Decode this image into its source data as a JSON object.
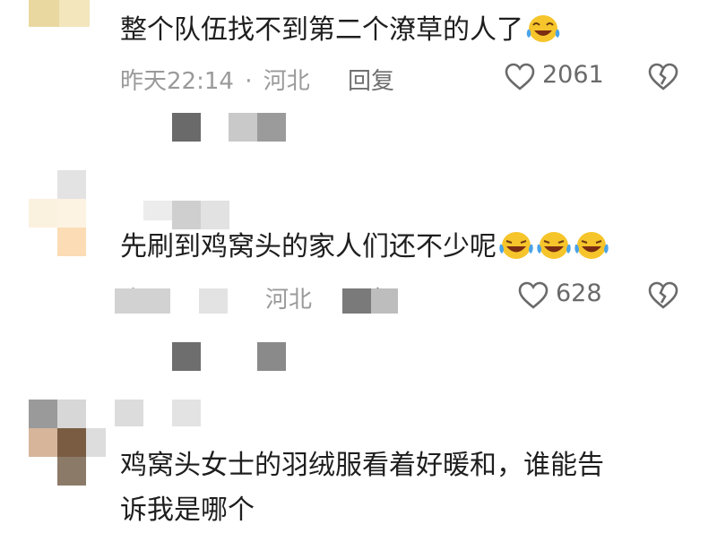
{
  "comments": [
    {
      "text": "整个队伍找不到第二个潦草的人了",
      "time": "昨天22:14",
      "separator": "·",
      "location": "河北",
      "reply_label": "回复",
      "likes": "2061",
      "emoji_count": 1
    },
    {
      "text": "先刷到鸡窝头的家人们还不少呢",
      "time": "昨天",
      "location": "河北",
      "reply_label": "回复",
      "likes": "628",
      "emoji_count": 3
    },
    {
      "text_line1": "鸡窝头女士的羽绒服看着好暖和，谁能告",
      "text_line2": "诉我是哪个"
    }
  ],
  "icons": {
    "like": "heart-outline-icon",
    "dislike": "broken-heart-icon",
    "emoji": "laughing-tears-emoji"
  },
  "colors": {
    "emoji_yellow": "#f6c52b",
    "emoji_tear": "#4aa3e8"
  }
}
